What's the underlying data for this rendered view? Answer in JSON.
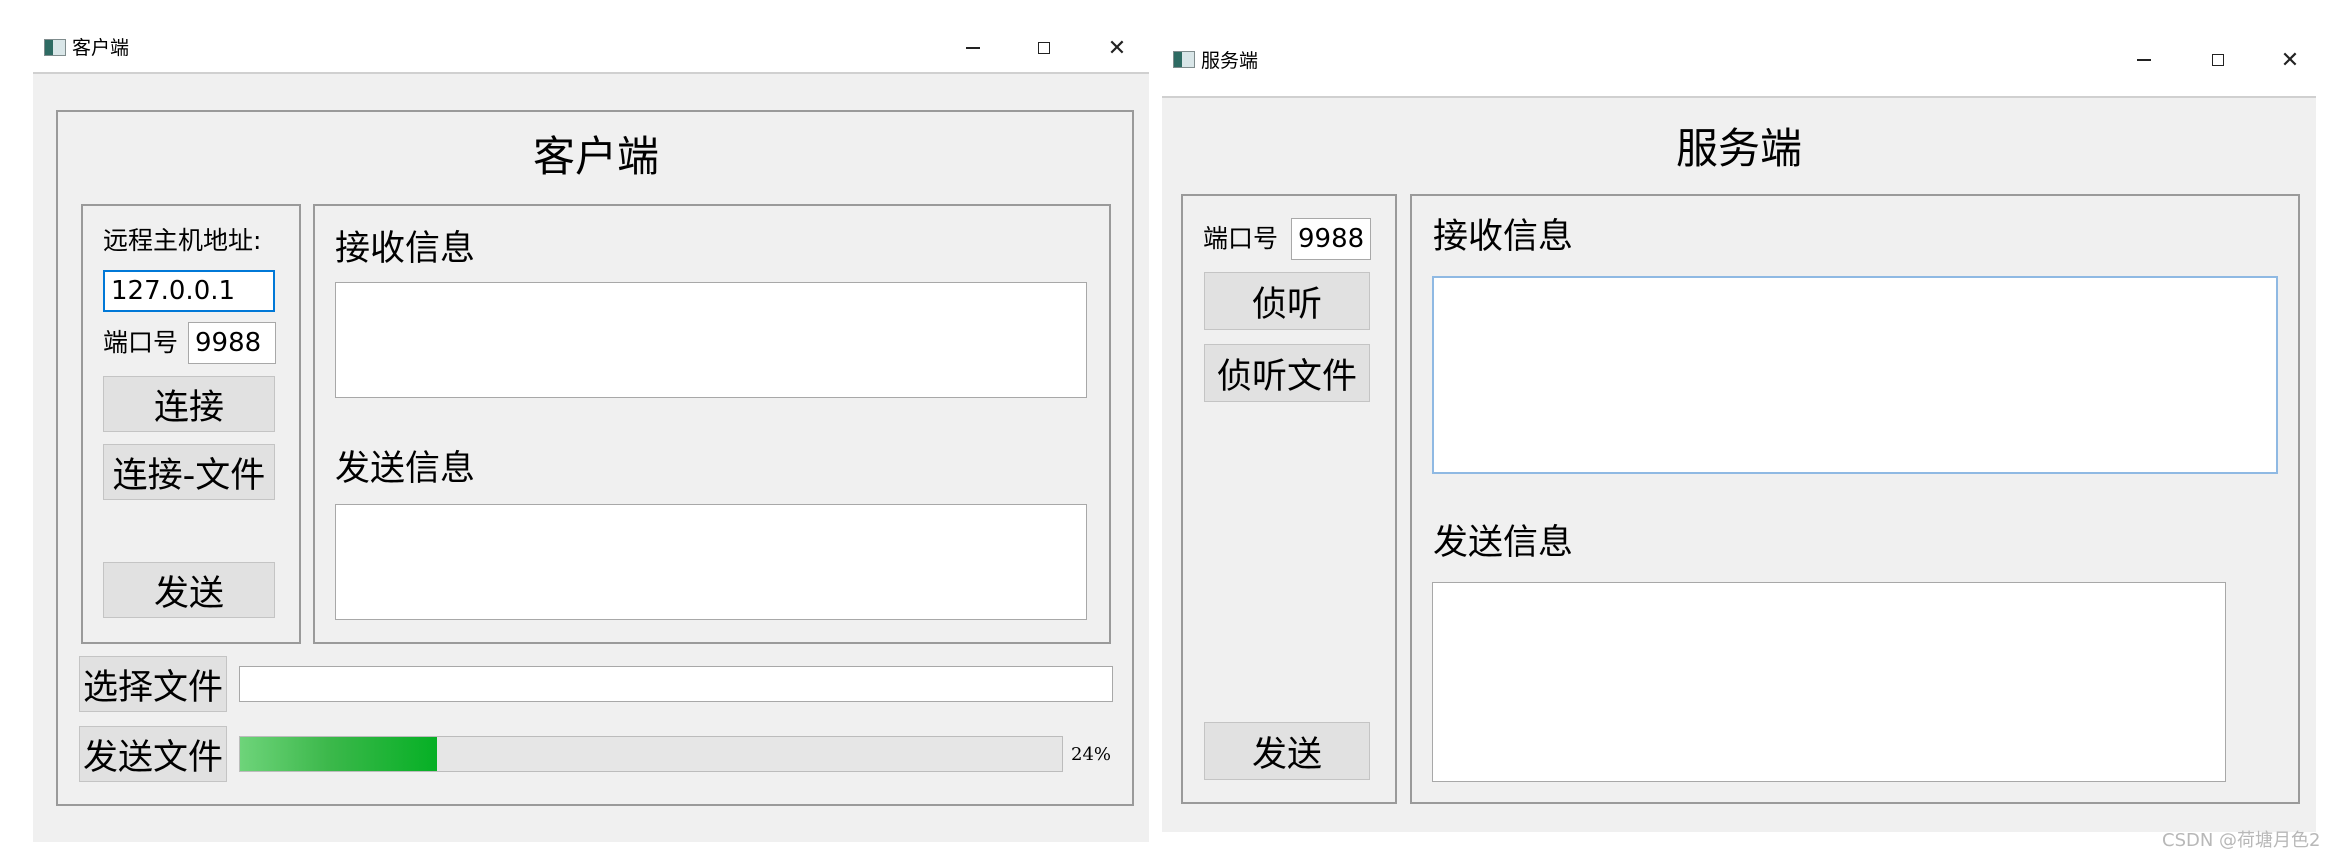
{
  "client_window": {
    "title": "客户端",
    "heading": "客户端",
    "remote_host_label": "远程主机地址:",
    "remote_host_value": "127.0.0.1",
    "port_label": "端口号",
    "port_value": "9988",
    "connect_button": "连接",
    "connect_file_button": "连接-文件",
    "send_button": "发送",
    "receive_label": "接收信息",
    "send_label": "发送信息",
    "choose_file_button": "选择文件",
    "file_path_value": "",
    "send_file_button": "发送文件",
    "progress_value": 24,
    "progress_text": "24%"
  },
  "server_window": {
    "title": "服务端",
    "heading": "服务端",
    "port_label": "端口号",
    "port_value": "9988",
    "listen_button": "侦听",
    "listen_file_button": "侦听文件",
    "send_button": "发送",
    "receive_label": "接收信息",
    "send_label": "发送信息"
  },
  "window_controls": {
    "minimize": "—",
    "maximize": "☐",
    "close": "✕"
  },
  "watermark": "CSDN @荷塘月色2",
  "colors": {
    "progress_fill": "#06b025",
    "focus_border": "#0078d7",
    "panel_bg": "#f0f0f0",
    "button_bg": "#e1e1e1"
  }
}
